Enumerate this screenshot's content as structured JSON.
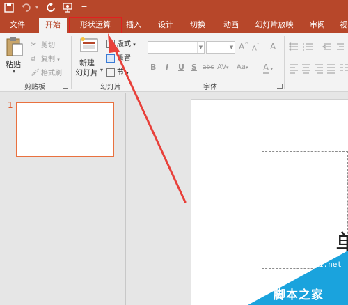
{
  "qat": {
    "save_icon": "save-icon",
    "undo_icon": "undo-icon",
    "redo_icon": "redo-icon",
    "present_icon": "present-icon",
    "customize_glyph": "="
  },
  "tabs": [
    {
      "label": "文件",
      "active": false
    },
    {
      "label": "开始",
      "active": true
    },
    {
      "label": "形状运算",
      "active": false
    },
    {
      "label": "插入",
      "active": false
    },
    {
      "label": "设计",
      "active": false
    },
    {
      "label": "切换",
      "active": false
    },
    {
      "label": "动画",
      "active": false
    },
    {
      "label": "幻灯片放映",
      "active": false
    },
    {
      "label": "审阅",
      "active": false
    },
    {
      "label": "视",
      "active": false
    }
  ],
  "ribbon": {
    "clipboard": {
      "paste": "粘贴",
      "cut": "剪切",
      "copy": "复制",
      "format_painter": "格式刷",
      "group_label": "剪贴板"
    },
    "slides": {
      "new_slide_line1": "新建",
      "new_slide_line2": "幻灯片",
      "layout": "版式",
      "reset": "重置",
      "section": "节",
      "group_label": "幻灯片"
    },
    "font": {
      "grow": "A",
      "shrink": "A",
      "clear": "A",
      "bold": "B",
      "italic": "I",
      "underline": "U",
      "shadow": "S",
      "strike": "abc",
      "spacing": "AV",
      "case": "Aa",
      "color": "A",
      "group_label": "字体"
    }
  },
  "slides_pane": {
    "slide_number": "1"
  },
  "slide": {
    "placeholder_glyph": "单"
  },
  "watermark": {
    "url": "jb51.net",
    "name": "脚本之家"
  },
  "colors": {
    "accent": "#b7472a",
    "highlight_box": "#e02020",
    "arrow": "#e8403a",
    "thumbnail_border": "#e9713f",
    "watermark_bg": "#1aa3dd"
  }
}
